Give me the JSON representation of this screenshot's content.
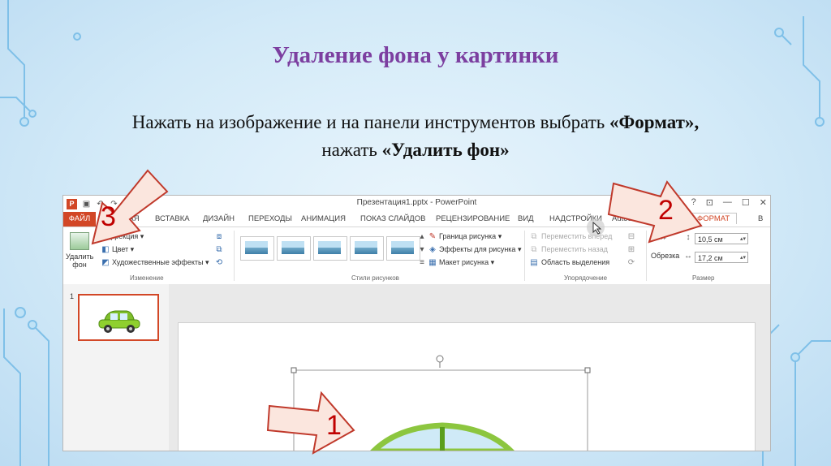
{
  "slide": {
    "title": "Удаление фона у картинки",
    "instruction": {
      "part1": "Нажать на изображение и  на панели инструментов выбрать ",
      "bold1": "«Формат»",
      "part2": ",",
      "part3": "нажать ",
      "bold2": "«Удалить фон»"
    }
  },
  "window": {
    "title": "Презентация1.pptx - PowerPoint",
    "app_icon_label": "P",
    "qat": [
      "save-icon",
      "undo-icon",
      "redo-icon"
    ],
    "controls": [
      "?",
      "⊡",
      "—",
      "☐",
      "✕"
    ]
  },
  "tabs": [
    "ФАЙЛ",
    "ГЛАВНАЯ",
    "ВСТАВКА",
    "ДИЗАЙН",
    "ПЕРЕХОДЫ",
    "АНИМАЦИЯ",
    "ПОКАЗ СЛАЙДОВ",
    "РЕЦЕНЗИРОВАНИЕ",
    "ВИД",
    "НАДСТРОЙКИ",
    "Autodesk",
    "ФОРМАТ",
    "В"
  ],
  "ribbon": {
    "change_group": {
      "remove_bg": [
        "Удалить",
        "фон"
      ],
      "correction": "Коррекция",
      "color": "Цвет",
      "artistic": "Художественные эффекты",
      "label": "Изменение"
    },
    "styles_group": {
      "border": "Граница рисунка",
      "effects": "Эффекты для рисунка",
      "layout": "Макет рисунка",
      "label": "Стили рисунков"
    },
    "arrange_group": {
      "forward": "Переместить вперед",
      "backward": "Переместить назад",
      "selection": "Область выделения",
      "label": "Упорядочение"
    },
    "size_group": {
      "crop": "Обрезка",
      "height": "10,5 см",
      "width": "17,2 см",
      "label": "Размер"
    }
  },
  "thumbnail_pane": {
    "slide_number": "1"
  },
  "annotations": {
    "arrow1": "1",
    "arrow2": "2",
    "arrow3": "3"
  },
  "colors": {
    "accent": "#d24726",
    "title": "#7c3fa0",
    "arrow_text": "#c00000"
  }
}
